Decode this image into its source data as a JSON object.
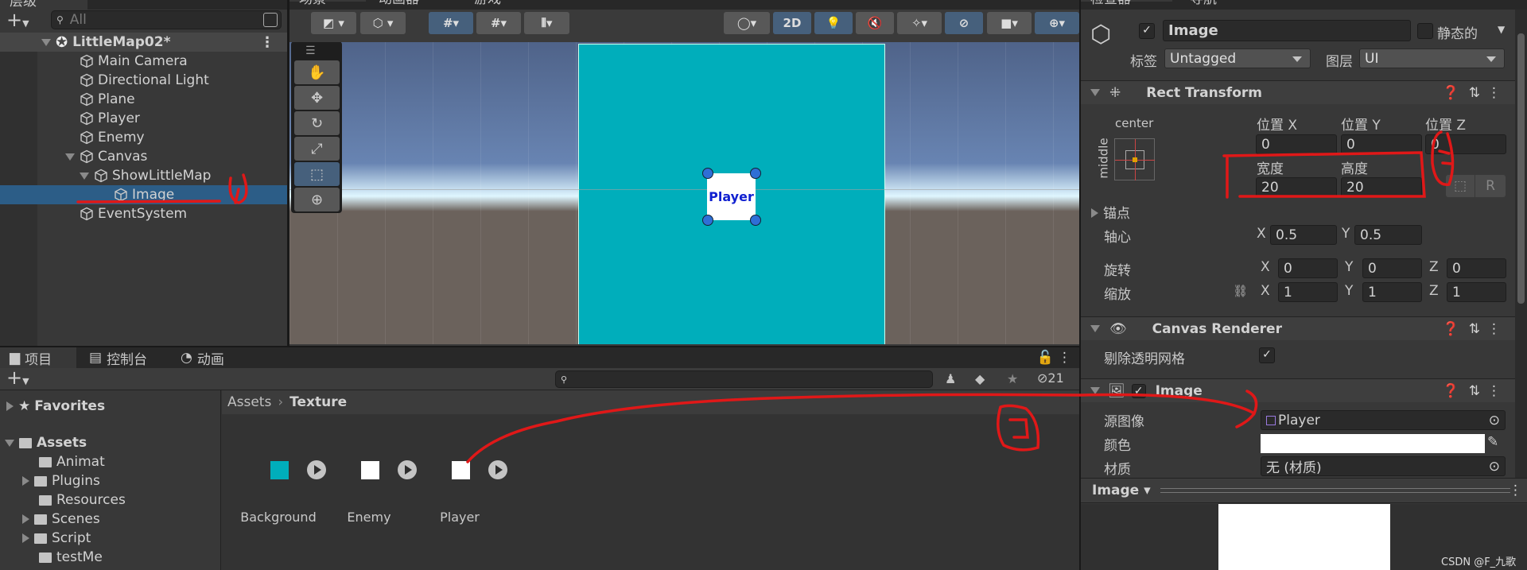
{
  "hierarchy": {
    "tab": "层级",
    "search_placeholder": "All",
    "scene": "LittleMap02*",
    "items": [
      {
        "label": "Main Camera",
        "depth": 1
      },
      {
        "label": "Directional Light",
        "depth": 1
      },
      {
        "label": "Plane",
        "depth": 1
      },
      {
        "label": "Player",
        "depth": 1
      },
      {
        "label": "Enemy",
        "depth": 1
      },
      {
        "label": "Canvas",
        "depth": 1,
        "expanded": true
      },
      {
        "label": "ShowLittleMap",
        "depth": 2,
        "expanded": true
      },
      {
        "label": "Image",
        "depth": 3,
        "selected": true
      },
      {
        "label": "EventSystem",
        "depth": 1
      }
    ]
  },
  "scene": {
    "tabs": [
      "场景",
      "动画器",
      "游戏"
    ],
    "mode_2d": "2D",
    "selected_image_label": "Player",
    "colors": {
      "canvas": "#00aebb",
      "sky": "#5a6f99",
      "ground": "#6b625c",
      "selection": "#2f6fd6"
    }
  },
  "inspector": {
    "tabs": [
      "检查器",
      "导航"
    ],
    "object_name": "Image",
    "active": true,
    "static_label": "静态的",
    "tag_label": "标签",
    "tag_value": "Untagged",
    "layer_label": "图层",
    "layer_value": "UI",
    "rect_transform": {
      "title": "Rect Transform",
      "anchor_h": "center",
      "anchor_v": "middle",
      "pos_x_label": "位置 X",
      "pos_y_label": "位置 Y",
      "pos_z_label": "位置 Z",
      "pos_x": "0",
      "pos_y": "0",
      "pos_z": "0",
      "width_label": "宽度",
      "height_label": "高度",
      "width": "20",
      "height": "20",
      "r_button": "R",
      "anchors_label": "锚点",
      "pivot_label": "轴心",
      "pivot_x": "0.5",
      "pivot_y": "0.5",
      "rotation_label": "旋转",
      "rot_x": "0",
      "rot_y": "0",
      "rot_z": "0",
      "scale_label": "缩放",
      "scale_x": "1",
      "scale_y": "1",
      "scale_z": "1",
      "x": "X",
      "y": "Y",
      "z": "Z"
    },
    "canvas_renderer": {
      "title": "Canvas Renderer",
      "cull_label": "剔除透明网格",
      "cull": true
    },
    "image": {
      "title": "Image",
      "enabled": true,
      "source_label": "源图像",
      "source_value": "Player",
      "color_label": "颜色",
      "color_value": "#ffffff",
      "material_label": "材质",
      "material_value": "无 (材质)"
    },
    "preview": {
      "title": "Image"
    }
  },
  "project": {
    "tabs": [
      "项目",
      "控制台",
      "动画"
    ],
    "hidden_count": "21",
    "favorites": "Favorites",
    "assets": "Assets",
    "folders": [
      {
        "label": "Animat",
        "expandable": false
      },
      {
        "label": "Plugins",
        "expandable": true
      },
      {
        "label": "Resources",
        "expandable": false
      },
      {
        "label": "Scenes",
        "expandable": true
      },
      {
        "label": "Script",
        "expandable": true
      },
      {
        "label": "testMe",
        "expandable": false
      }
    ],
    "breadcrumb": [
      "Assets",
      "Texture"
    ],
    "files": [
      {
        "label": "Background",
        "thumb": "#00aebb"
      },
      {
        "label": "Enemy",
        "thumb": "#ffffff"
      },
      {
        "label": "Player",
        "thumb": "#ffffff"
      }
    ]
  },
  "watermark": "CSDN @F_九歌"
}
